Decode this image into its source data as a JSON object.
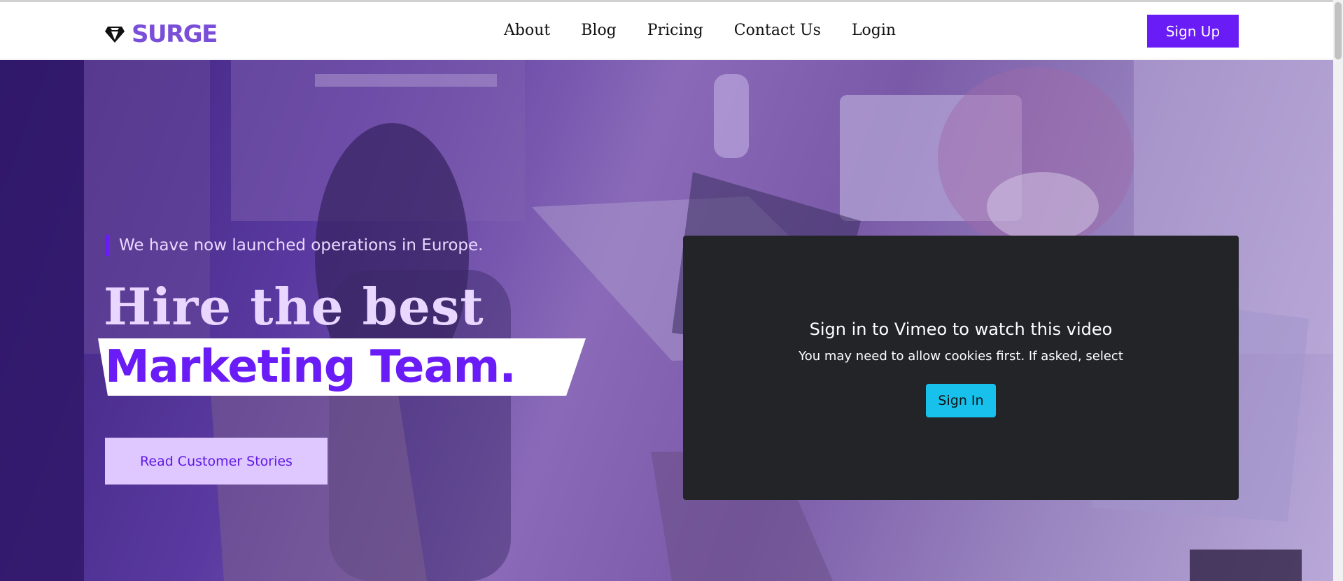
{
  "brand": {
    "name": "SURGE",
    "color": "#7a4fd8",
    "icon": "gem-icon"
  },
  "nav": {
    "links": [
      {
        "label": "About"
      },
      {
        "label": "Blog"
      },
      {
        "label": "Pricing"
      },
      {
        "label": "Contact Us"
      },
      {
        "label": "Login"
      }
    ],
    "signup_label": "Sign Up"
  },
  "hero": {
    "tagline": "We have now launched operations in Europe.",
    "headline_line1": "Hire the best",
    "headline_line2": "Marketing Team.",
    "cta_label": "Read Customer Stories",
    "background": "photo: people working on laptops at a wooden table, purple overlay"
  },
  "video": {
    "title": "Sign in to Vimeo to watch this video",
    "subtitle": "You may need to allow cookies first. If asked, select",
    "signin_label": "Sign In"
  },
  "colors": {
    "accent": "#6a1cf6",
    "headline_light": "#ead7ff",
    "cta_bg": "#dfc7ff",
    "video_bg": "#222428",
    "vimeo_button": "#17c1ec"
  }
}
